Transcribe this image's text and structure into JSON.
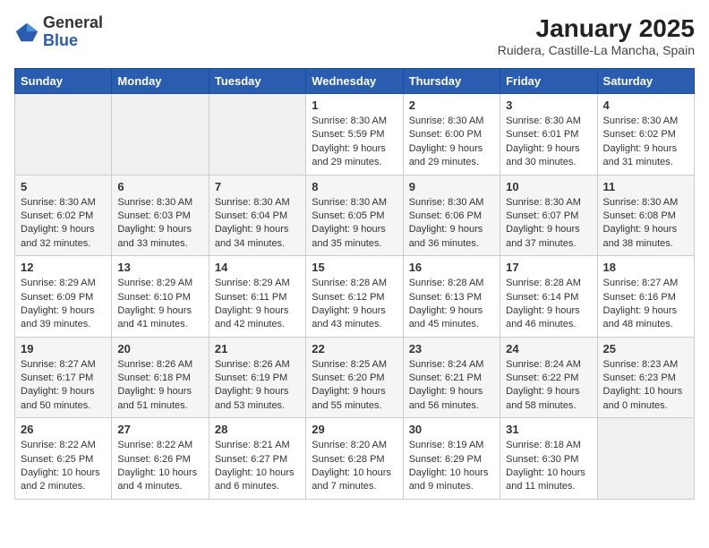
{
  "logo": {
    "general": "General",
    "blue": "Blue"
  },
  "title": "January 2025",
  "subtitle": "Ruidera, Castille-La Mancha, Spain",
  "headers": [
    "Sunday",
    "Monday",
    "Tuesday",
    "Wednesday",
    "Thursday",
    "Friday",
    "Saturday"
  ],
  "weeks": [
    [
      {
        "day": "",
        "content": ""
      },
      {
        "day": "",
        "content": ""
      },
      {
        "day": "",
        "content": ""
      },
      {
        "day": "1",
        "content": "Sunrise: 8:30 AM\nSunset: 5:59 PM\nDaylight: 9 hours and 29 minutes."
      },
      {
        "day": "2",
        "content": "Sunrise: 8:30 AM\nSunset: 6:00 PM\nDaylight: 9 hours and 29 minutes."
      },
      {
        "day": "3",
        "content": "Sunrise: 8:30 AM\nSunset: 6:01 PM\nDaylight: 9 hours and 30 minutes."
      },
      {
        "day": "4",
        "content": "Sunrise: 8:30 AM\nSunset: 6:02 PM\nDaylight: 9 hours and 31 minutes."
      }
    ],
    [
      {
        "day": "5",
        "content": "Sunrise: 8:30 AM\nSunset: 6:02 PM\nDaylight: 9 hours and 32 minutes."
      },
      {
        "day": "6",
        "content": "Sunrise: 8:30 AM\nSunset: 6:03 PM\nDaylight: 9 hours and 33 minutes."
      },
      {
        "day": "7",
        "content": "Sunrise: 8:30 AM\nSunset: 6:04 PM\nDaylight: 9 hours and 34 minutes."
      },
      {
        "day": "8",
        "content": "Sunrise: 8:30 AM\nSunset: 6:05 PM\nDaylight: 9 hours and 35 minutes."
      },
      {
        "day": "9",
        "content": "Sunrise: 8:30 AM\nSunset: 6:06 PM\nDaylight: 9 hours and 36 minutes."
      },
      {
        "day": "10",
        "content": "Sunrise: 8:30 AM\nSunset: 6:07 PM\nDaylight: 9 hours and 37 minutes."
      },
      {
        "day": "11",
        "content": "Sunrise: 8:30 AM\nSunset: 6:08 PM\nDaylight: 9 hours and 38 minutes."
      }
    ],
    [
      {
        "day": "12",
        "content": "Sunrise: 8:29 AM\nSunset: 6:09 PM\nDaylight: 9 hours and 39 minutes."
      },
      {
        "day": "13",
        "content": "Sunrise: 8:29 AM\nSunset: 6:10 PM\nDaylight: 9 hours and 41 minutes."
      },
      {
        "day": "14",
        "content": "Sunrise: 8:29 AM\nSunset: 6:11 PM\nDaylight: 9 hours and 42 minutes."
      },
      {
        "day": "15",
        "content": "Sunrise: 8:28 AM\nSunset: 6:12 PM\nDaylight: 9 hours and 43 minutes."
      },
      {
        "day": "16",
        "content": "Sunrise: 8:28 AM\nSunset: 6:13 PM\nDaylight: 9 hours and 45 minutes."
      },
      {
        "day": "17",
        "content": "Sunrise: 8:28 AM\nSunset: 6:14 PM\nDaylight: 9 hours and 46 minutes."
      },
      {
        "day": "18",
        "content": "Sunrise: 8:27 AM\nSunset: 6:16 PM\nDaylight: 9 hours and 48 minutes."
      }
    ],
    [
      {
        "day": "19",
        "content": "Sunrise: 8:27 AM\nSunset: 6:17 PM\nDaylight: 9 hours and 50 minutes."
      },
      {
        "day": "20",
        "content": "Sunrise: 8:26 AM\nSunset: 6:18 PM\nDaylight: 9 hours and 51 minutes."
      },
      {
        "day": "21",
        "content": "Sunrise: 8:26 AM\nSunset: 6:19 PM\nDaylight: 9 hours and 53 minutes."
      },
      {
        "day": "22",
        "content": "Sunrise: 8:25 AM\nSunset: 6:20 PM\nDaylight: 9 hours and 55 minutes."
      },
      {
        "day": "23",
        "content": "Sunrise: 8:24 AM\nSunset: 6:21 PM\nDaylight: 9 hours and 56 minutes."
      },
      {
        "day": "24",
        "content": "Sunrise: 8:24 AM\nSunset: 6:22 PM\nDaylight: 9 hours and 58 minutes."
      },
      {
        "day": "25",
        "content": "Sunrise: 8:23 AM\nSunset: 6:23 PM\nDaylight: 10 hours and 0 minutes."
      }
    ],
    [
      {
        "day": "26",
        "content": "Sunrise: 8:22 AM\nSunset: 6:25 PM\nDaylight: 10 hours and 2 minutes."
      },
      {
        "day": "27",
        "content": "Sunrise: 8:22 AM\nSunset: 6:26 PM\nDaylight: 10 hours and 4 minutes."
      },
      {
        "day": "28",
        "content": "Sunrise: 8:21 AM\nSunset: 6:27 PM\nDaylight: 10 hours and 6 minutes."
      },
      {
        "day": "29",
        "content": "Sunrise: 8:20 AM\nSunset: 6:28 PM\nDaylight: 10 hours and 7 minutes."
      },
      {
        "day": "30",
        "content": "Sunrise: 8:19 AM\nSunset: 6:29 PM\nDaylight: 10 hours and 9 minutes."
      },
      {
        "day": "31",
        "content": "Sunrise: 8:18 AM\nSunset: 6:30 PM\nDaylight: 10 hours and 11 minutes."
      },
      {
        "day": "",
        "content": ""
      }
    ]
  ],
  "colors": {
    "header_bg": "#2a5db0",
    "header_text": "#ffffff",
    "even_row": "#f5f5f5",
    "odd_row": "#ffffff",
    "empty_cell": "#f0f0f0"
  }
}
